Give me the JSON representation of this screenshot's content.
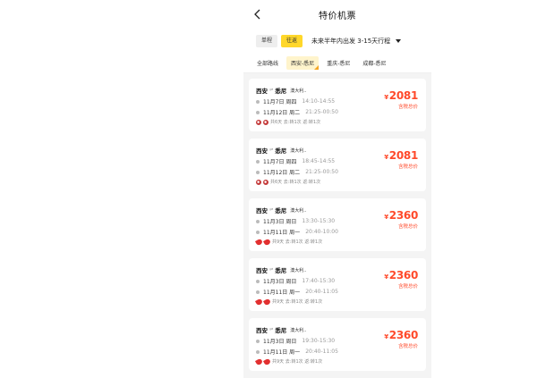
{
  "nav": {
    "title": "特价机票"
  },
  "filters": {
    "single_label": "单程",
    "round_label": "往返",
    "range_label": "未来半年内出发 3-15天行程"
  },
  "routes": [
    {
      "label": "全部路线",
      "active": false
    },
    {
      "label": "西安-悉尼",
      "active": true
    },
    {
      "label": "重庆-悉尼",
      "active": false
    },
    {
      "label": "成都-悉尼",
      "active": false
    }
  ],
  "cards": [
    {
      "from": "西安",
      "arrow": "⇌",
      "to": "悉尼",
      "country": "澳大利..",
      "out_date": "11月7日 周四",
      "out_time": "14:10-14:55",
      "ret_date": "11月12日 周二",
      "ret_time": "21:25-00:50",
      "meta": "共6天 去:转1次 返:转1次",
      "currency": "¥",
      "price": "2081",
      "price_label": "含税总价",
      "airline": "a"
    },
    {
      "from": "西安",
      "arrow": "⇌",
      "to": "悉尼",
      "country": "澳大利..",
      "out_date": "11月7日 周四",
      "out_time": "18:45-14:55",
      "ret_date": "11月12日 周二",
      "ret_time": "21:25-00:50",
      "meta": "共6天 去:转1次 返:转1次",
      "currency": "¥",
      "price": "2081",
      "price_label": "含税总价",
      "airline": "a"
    },
    {
      "from": "西安",
      "arrow": "⇌",
      "to": "悉尼",
      "country": "澳大利..",
      "out_date": "11月3日 周日",
      "out_time": "13:30-15:30",
      "ret_date": "11月11日 周一",
      "ret_time": "20:40-10:00",
      "meta": "共9天 去:转1次 返:转1次",
      "currency": "¥",
      "price": "2360",
      "price_label": "含税总价",
      "airline": "b"
    },
    {
      "from": "西安",
      "arrow": "⇌",
      "to": "悉尼",
      "country": "澳大利..",
      "out_date": "11月3日 周日",
      "out_time": "17:40-15:30",
      "ret_date": "11月11日 周一",
      "ret_time": "20:40-11:05",
      "meta": "共9天 去:转1次 返:转1次",
      "currency": "¥",
      "price": "2360",
      "price_label": "含税总价",
      "airline": "b"
    },
    {
      "from": "西安",
      "arrow": "⇌",
      "to": "悉尼",
      "country": "澳大利..",
      "out_date": "11月3日 周日",
      "out_time": "19:30-15:30",
      "ret_date": "11月11日 周一",
      "ret_time": "20:40-11:05",
      "meta": "共9天 去:转1次 返:转1次",
      "currency": "¥",
      "price": "2360",
      "price_label": "含税总价",
      "airline": "b"
    }
  ],
  "colors": {
    "accent": "#ffd72a",
    "price": "#ff4a2b"
  }
}
